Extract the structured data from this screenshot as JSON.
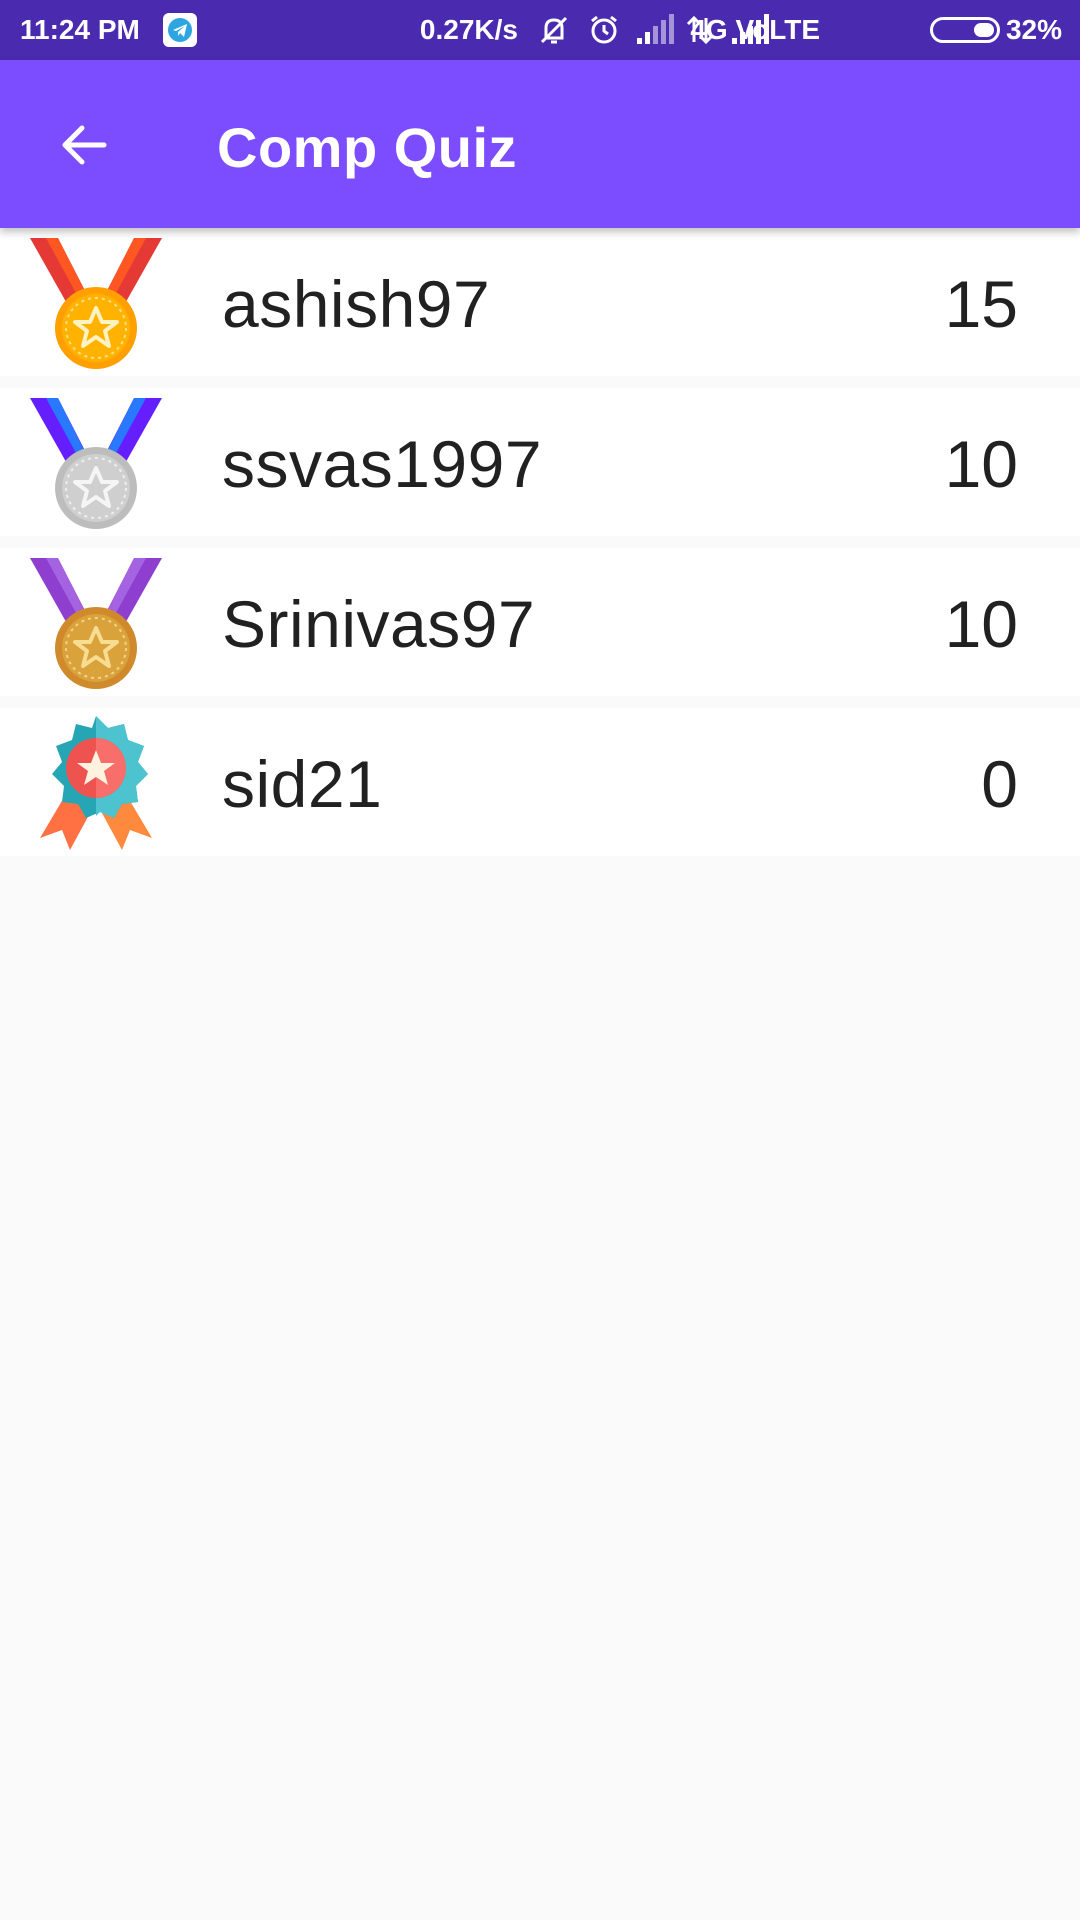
{
  "status_bar": {
    "time": "11:24 PM",
    "speed": "0.27K/s",
    "network": "4G VoLTE",
    "battery": "32%",
    "icons": [
      "telegram-icon",
      "mute-icon",
      "alarm-icon",
      "signal-icon",
      "data-arrows-icon",
      "signal-icon"
    ]
  },
  "app_bar": {
    "title": "Comp Quiz",
    "back_icon": "arrow-left-icon",
    "color": "#7c4dff"
  },
  "leaderboard": [
    {
      "name": "ashish97",
      "score": "15",
      "icon": "gold-medal-icon"
    },
    {
      "name": "ssvas1997",
      "score": "10",
      "icon": "silver-medal-icon"
    },
    {
      "name": "Srinivas97",
      "score": "10",
      "icon": "bronze-medal-icon"
    },
    {
      "name": "sid21",
      "score": "0",
      "icon": "award-badge-icon"
    }
  ]
}
